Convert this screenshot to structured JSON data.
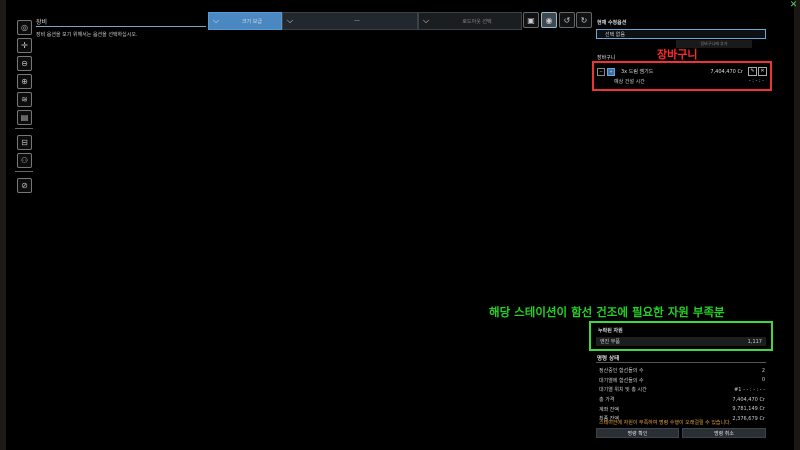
{
  "header": {
    "panel_title": "장비",
    "instruction": "장비 옵션을 보기 위해서는 옵션을 선택하십시오.",
    "dropdown_size": "크기 보급",
    "dropdown_type": "---",
    "dropdown_loadout": "로드아웃 선택"
  },
  "right_panel": {
    "title": "현재 수정옵션",
    "select_button": "선택 없음",
    "add_to_cart_button": "장바구니에 추가",
    "cart_header": "장바구니",
    "cart_annotation": "장바구니",
    "cart_items": [
      {
        "name": "3x 드림 엠기드",
        "price": "7,404,470 Cr",
        "sub_label": "예상 건설 시간",
        "sub_value": "- : - : -"
      }
    ],
    "shortage_annotation": "해당 스테이션이 함선 건조에 필요한 자원 부족분",
    "shortage_title": "누락된 자원",
    "shortage_rows": [
      {
        "label": "엔진 부품",
        "value": "1,117"
      }
    ],
    "order_title": "명령 상태",
    "order_rows": [
      {
        "label": "정산중인 함선들의 수",
        "value": "2"
      },
      {
        "label": "대기열에 함선들의 수",
        "value": "0"
      },
      {
        "label": "대기열 위치 및 총 시간",
        "value": "#1 - - : - : - -"
      },
      {
        "label": "총 가격",
        "value": "7,404,470 Cr"
      },
      {
        "label": "계좌 잔액",
        "value": "9,781,149 Cr"
      },
      {
        "label": "최종 잔액",
        "value": "2,376,679 Cr"
      }
    ],
    "warning": "스테이션에 자원이 부족하여 명령 수행이 오래걸릴 수 있습니다.",
    "confirm_button": "명령 확인",
    "cancel_button": "명령 취소"
  },
  "colors": {
    "red_annotation": "#ff2a2a",
    "green_annotation": "#24d024",
    "accent_blue": "#4a88c2",
    "warning_orange": "#e7a13a"
  }
}
